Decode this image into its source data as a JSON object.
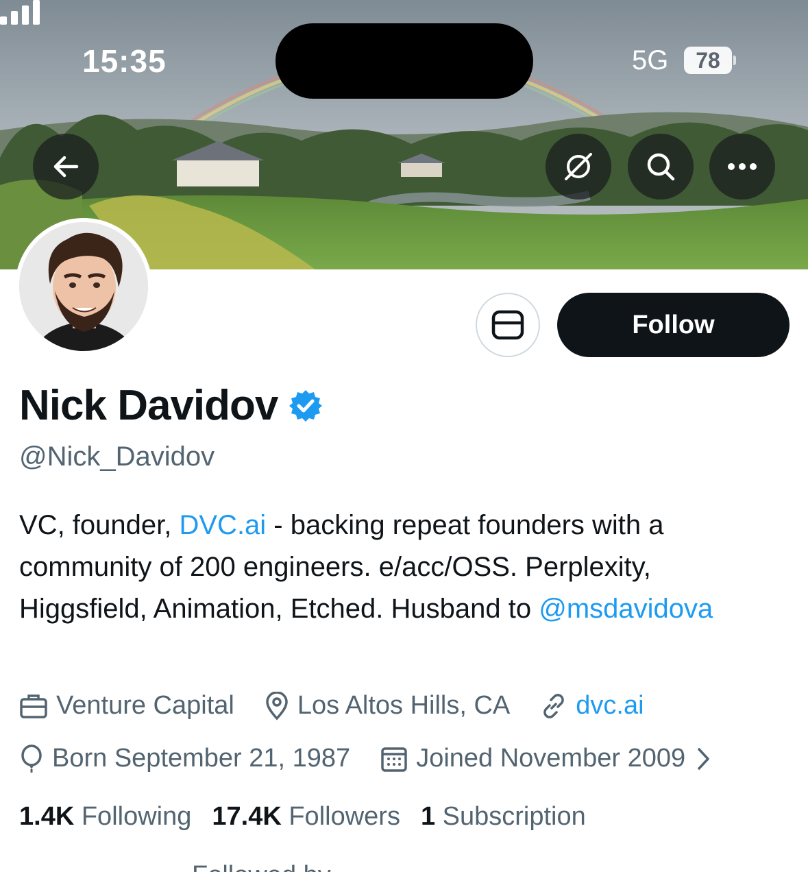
{
  "status_bar": {
    "time": "15:35",
    "network": "5G",
    "battery": "78"
  },
  "banner": {
    "back_icon": "arrow-left-icon",
    "grok_icon": "grok-icon",
    "search_icon": "search-icon",
    "more_icon": "more-horizontal-icon"
  },
  "actions": {
    "message_icon": "envelope-icon",
    "follow_label": "Follow"
  },
  "profile": {
    "display_name": "Nick Davidov",
    "handle": "@Nick_Davidov",
    "verified_color": "#1d9bf0",
    "bio": {
      "part1": "VC, founder, ",
      "link1": "DVC.ai",
      "part2": " - backing repeat founders with a community of 200 engineers. e/acc/OSS. Perplexity, Higgsfield, Animation, Etched. Husband to ",
      "mention": "@msdavidova"
    },
    "meta": {
      "category": "Venture Capital",
      "location": "Los Altos Hills, CA",
      "website": "dvc.ai",
      "birthday": "Born September 21, 1987",
      "joined": "Joined November 2009"
    },
    "stats": {
      "following_count": "1.4K",
      "following_label": "Following",
      "followers_count": "17.4K",
      "followers_label": "Followers",
      "subscriptions_count": "1",
      "subscriptions_label": "Subscription"
    },
    "followed_by": "Followed by ..."
  },
  "colors": {
    "accent": "#1d9bf0",
    "text_primary": "#0f1419",
    "text_secondary": "#536471",
    "follow_button_bg": "#0f1419"
  }
}
